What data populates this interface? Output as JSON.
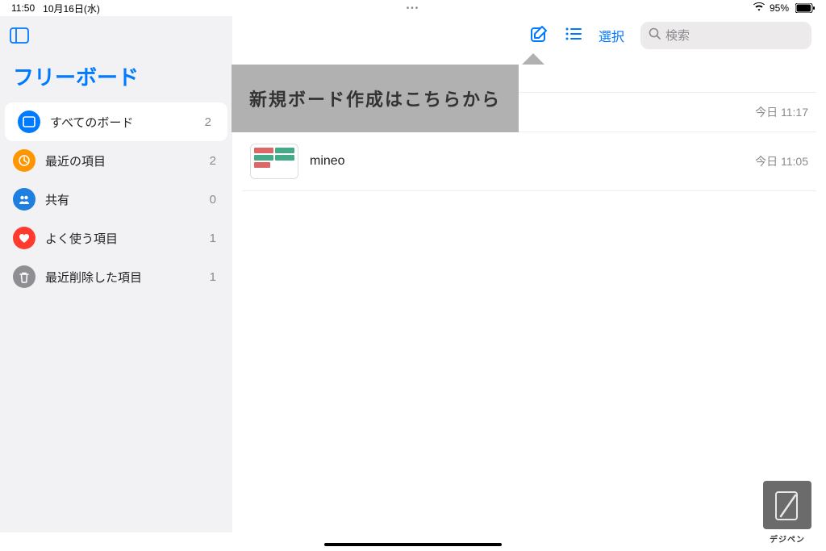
{
  "status": {
    "time": "11:50",
    "date": "10月16日(水)",
    "battery_pct": "95%"
  },
  "sidebar": {
    "title": "フリーボード",
    "items": [
      {
        "label": "すべてのボード",
        "count": "2",
        "icon": "board-icon",
        "color": "#007aff"
      },
      {
        "label": "最近の項目",
        "count": "2",
        "icon": "clock-icon",
        "color": "#ff9500"
      },
      {
        "label": "共有",
        "count": "0",
        "icon": "people-icon",
        "color": "#1e7fe0"
      },
      {
        "label": "よく使う項目",
        "count": "1",
        "icon": "heart-icon",
        "color": "#ff3b30"
      },
      {
        "label": "最近削除した項目",
        "count": "1",
        "icon": "trash-icon",
        "color": "#8e8e93"
      }
    ]
  },
  "toolbar": {
    "select_label": "選択",
    "search_placeholder": "検索"
  },
  "hint_text": "新規ボード作成はこちらから",
  "boards": [
    {
      "name": "",
      "time": "今日 11:17"
    },
    {
      "name": "mineo",
      "time": "今日 11:05"
    }
  ],
  "logo_label": "デジペン"
}
